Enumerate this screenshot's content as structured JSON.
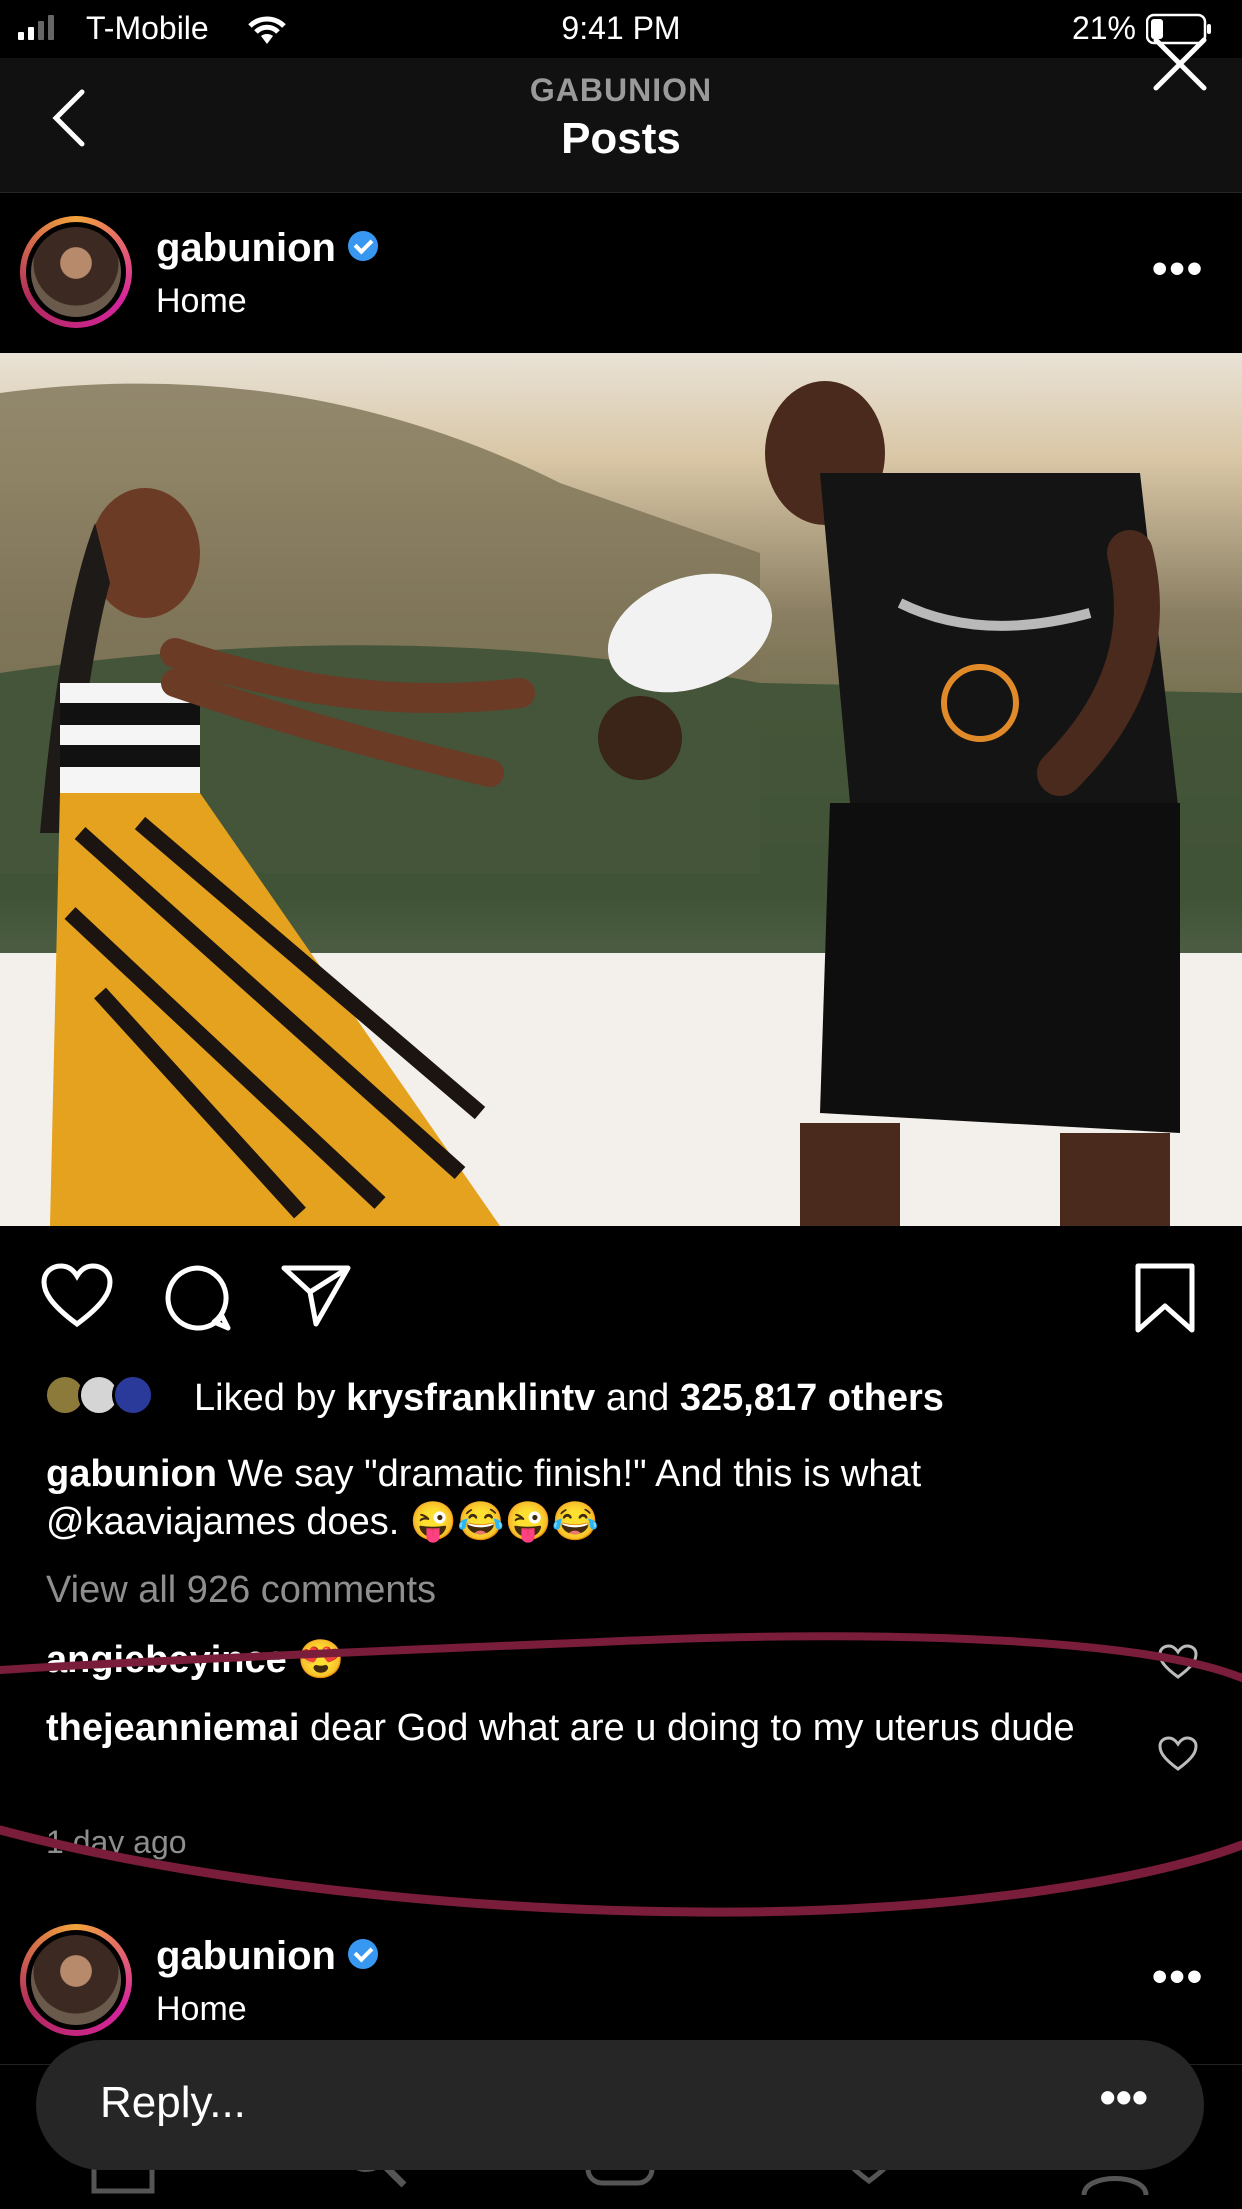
{
  "status_bar": {
    "carrier": "T-Mobile",
    "time": "9:41 PM",
    "battery": "21%"
  },
  "nav": {
    "subtitle": "GABUNION",
    "title": "Posts"
  },
  "post": {
    "username": "gabunion",
    "location": "Home",
    "likes": {
      "prefix": "Liked by ",
      "user": "krysfranklintv",
      "mid": " and ",
      "count": "325,817 others"
    },
    "caption": {
      "user": "gabunion",
      "text": " We say \"dramatic finish!\" And this is what @kaaviajames does. 😜😂😜😂"
    },
    "view_comments": "View all 926 comments",
    "comments": [
      {
        "user": "angiebeyince",
        "text": " 😍"
      },
      {
        "user": "thejeanniemai",
        "text": " dear God what are u doing to my uterus dude"
      }
    ],
    "time_ago": "1 day ago"
  },
  "next_post": {
    "username": "gabunion",
    "location": "Home"
  },
  "reply_bar": {
    "placeholder": "Reply..."
  },
  "icons": [
    "back-icon",
    "close-icon",
    "heart-icon",
    "comment-icon",
    "share-icon",
    "bookmark-icon",
    "verified-icon",
    "more-icon",
    "search-icon",
    "add-icon",
    "profile-icon",
    "home-icon"
  ],
  "colors": {
    "background": "#000000",
    "verified": "#3897f0",
    "annotation": "#7a1d3a",
    "story_ring": "#d6249f"
  }
}
